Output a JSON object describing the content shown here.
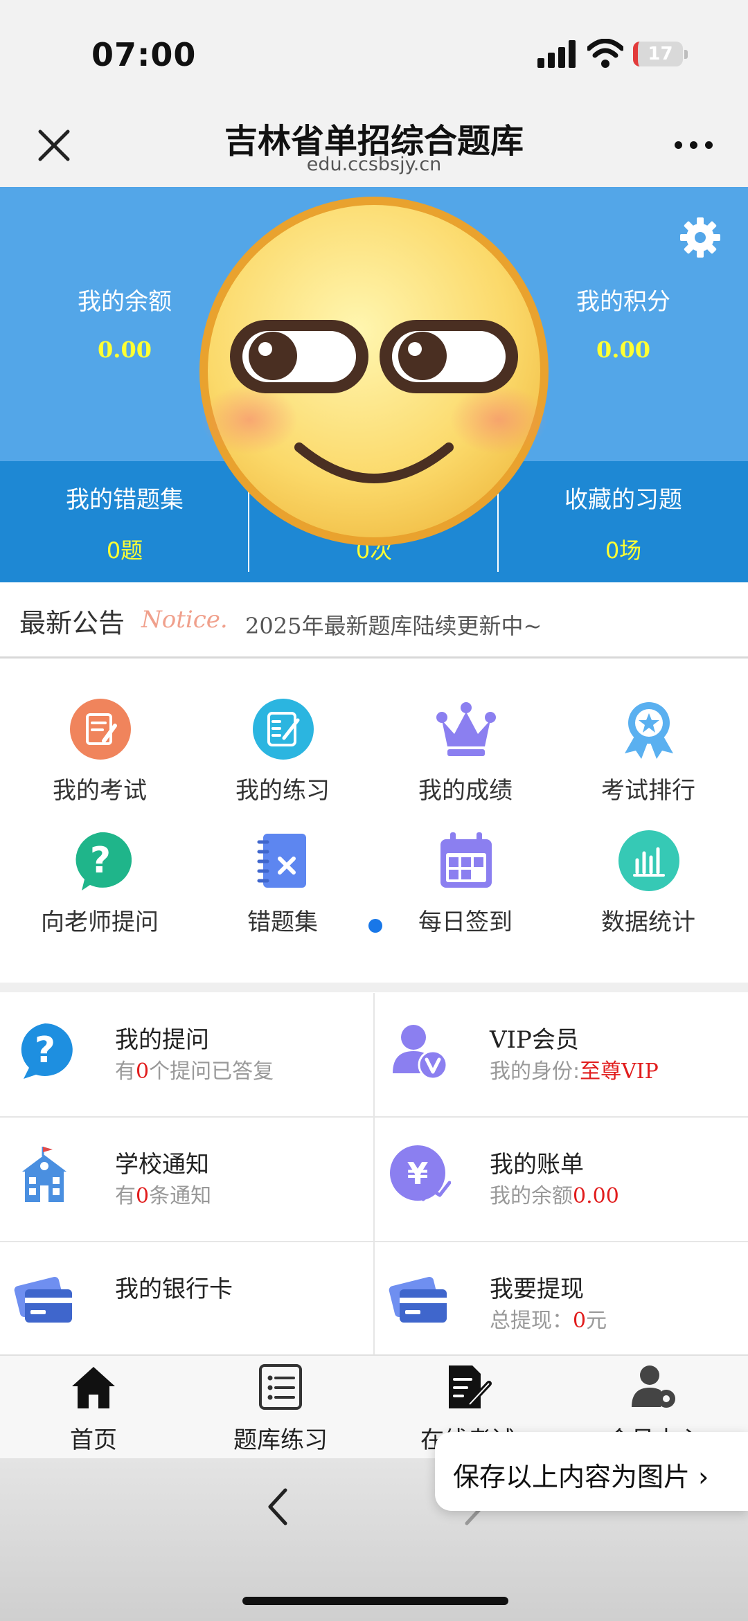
{
  "status_bar": {
    "time": "07:00",
    "battery": "17"
  },
  "title_bar": {
    "title": "吉林省单招综合题库",
    "subtitle": "edu.ccsbsjy.cn"
  },
  "header": {
    "balance_label": "我的余额",
    "balance_value": "0.00",
    "points_label": "我的积分",
    "points_value": "0.00",
    "wrong_label": "我的错题集",
    "wrong_value": "0题",
    "middle_value": "0次",
    "favorites_label": "收藏的习题",
    "favorites_value": "0场"
  },
  "notice": {
    "title": "最新公告",
    "title_en": "Notice.",
    "text": "2025年最新题库陆续更新中~"
  },
  "grid": [
    {
      "label": "我的考试",
      "icon": "exam-icon",
      "color": "#f0845c"
    },
    {
      "label": "我的练习",
      "icon": "practice-icon",
      "color": "#2bb5e0"
    },
    {
      "label": "我的成绩",
      "icon": "crown-icon",
      "color": "#8b7ff0"
    },
    {
      "label": "考试排行",
      "icon": "award-icon",
      "color": "#5ab0f0"
    },
    {
      "label": "向老师提问",
      "icon": "question-bubble-icon",
      "color": "#1fb58a"
    },
    {
      "label": "错题集",
      "icon": "wrong-notebook-icon",
      "color": "#5d86f0"
    },
    {
      "label": "每日签到",
      "icon": "calendar-icon",
      "color": "#8b7ff0"
    },
    {
      "label": "数据统计",
      "icon": "stats-icon",
      "color": "#36c9b5"
    }
  ],
  "cells": {
    "questions": {
      "title": "我的提问",
      "sub_pre": "有",
      "sub_num": "0",
      "sub_post": "个提问已答复"
    },
    "vip": {
      "title": "VIP会员",
      "sub_pre": "我的身份:",
      "sub_red": "至尊VIP"
    },
    "school": {
      "title": "学校通知",
      "sub_pre": "有",
      "sub_num": "0",
      "sub_post": "条通知"
    },
    "bill": {
      "title": "我的账单",
      "sub_pre": "我的余额",
      "sub_red": "0.00"
    },
    "bankcard": {
      "title": "我的银行卡"
    },
    "withdraw": {
      "title": "我要提现",
      "sub_pre": "总提现：",
      "sub_num": "0",
      "sub_post": "元"
    }
  },
  "tabbar": [
    {
      "label": "首页",
      "icon": "home-icon"
    },
    {
      "label": "题库练习",
      "icon": "list-icon"
    },
    {
      "label": "在线考试",
      "icon": "edit-doc-icon"
    },
    {
      "label": "会员中心",
      "icon": "user-settings-icon"
    }
  ],
  "save_popup": {
    "label": "保存以上内容为图片 ›"
  }
}
